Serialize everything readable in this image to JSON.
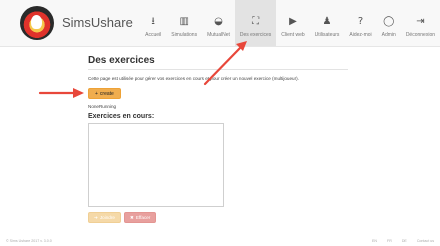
{
  "header": {
    "brand": "SimsUshare",
    "nav": [
      {
        "label": "Accueil",
        "icon": "download-icon",
        "glyph": "⭳"
      },
      {
        "label": "Simulations",
        "icon": "map-icon",
        "glyph": "▥"
      },
      {
        "label": "MutualNet",
        "icon": "helmet-icon",
        "glyph": "◒"
      },
      {
        "label": "Des exercices",
        "icon": "sitemap-icon",
        "glyph": "⛶"
      },
      {
        "label": "Client web",
        "icon": "play-icon",
        "glyph": "▶"
      },
      {
        "label": "Utilisateurs",
        "icon": "users-icon",
        "glyph": "♟"
      },
      {
        "label": "Aidez-moi",
        "icon": "question-icon",
        "glyph": "?"
      },
      {
        "label": "Admin",
        "icon": "user-icon",
        "glyph": "◯"
      },
      {
        "label": "Déconnexion",
        "icon": "logout-icon",
        "glyph": "⇥"
      }
    ],
    "active_index": 3
  },
  "main": {
    "title": "Des exercices",
    "description": "Cette page est utilisée pour gérer vos exercices en cours et pour créer un nouvel exercice (multijoueur).",
    "create_label": "create",
    "create_icon": "plus-icon",
    "status": "NoneRunning",
    "section_title": "Exercices en cours:",
    "join_label": "Joindre",
    "join_icon": "sign-in-icon",
    "delete_label": "Effacer",
    "delete_icon": "times-icon"
  },
  "footer": {
    "copyright": "© Sims Ushare 2017 v. 3.0.0",
    "langs": [
      "EN",
      "FR",
      "DE",
      "Contact us"
    ]
  },
  "colors": {
    "accent_orange": "#f0ad4e",
    "arrow_red": "#e8473a",
    "delete_red": "#e8a09e"
  }
}
